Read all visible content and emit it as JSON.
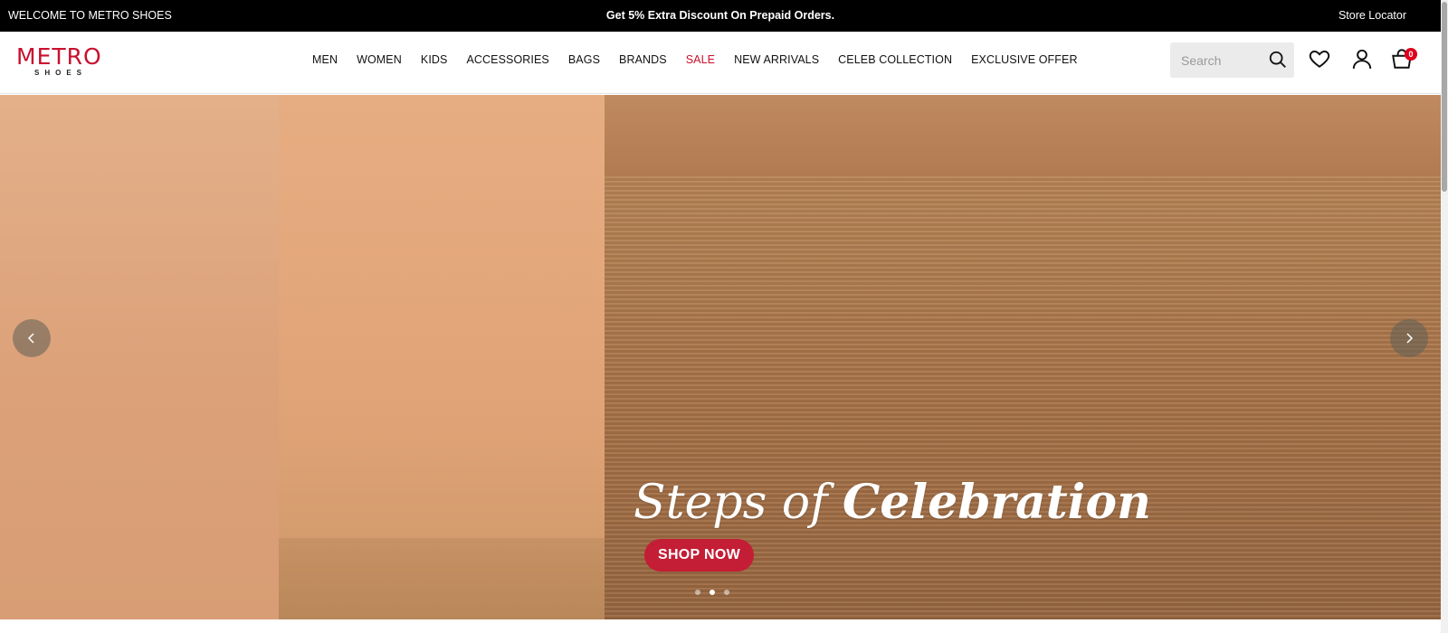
{
  "topbar": {
    "welcome": "WELCOME TO METRO SHOES",
    "promo": "Get 5% Extra Discount On Prepaid Orders.",
    "store_locator": "Store Locator"
  },
  "header": {
    "logo": {
      "brand": "METRO",
      "sub": "SHOES"
    },
    "nav": [
      {
        "label": "MEN"
      },
      {
        "label": "WOMEN"
      },
      {
        "label": "KIDS"
      },
      {
        "label": "ACCESSORIES"
      },
      {
        "label": "BAGS"
      },
      {
        "label": "BRANDS"
      },
      {
        "label": "SALE"
      },
      {
        "label": "NEW ARRIVALS"
      },
      {
        "label": "CELEB COLLECTION"
      },
      {
        "label": "EXCLUSIVE OFFER"
      }
    ],
    "search": {
      "placeholder": "Search",
      "value": ""
    },
    "icons": {
      "wishlist": "heart-icon",
      "account": "user-icon",
      "cart": "shopping-bag-icon"
    },
    "cart_count": "0"
  },
  "hero": {
    "title_part1": "Steps of ",
    "title_part2": "Celebration",
    "cta": "SHOP NOW",
    "slides": 3,
    "active_slide": 2
  },
  "colors": {
    "brand": "#c8102e",
    "cta": "#c41d36",
    "topbar_bg": "#000000"
  }
}
